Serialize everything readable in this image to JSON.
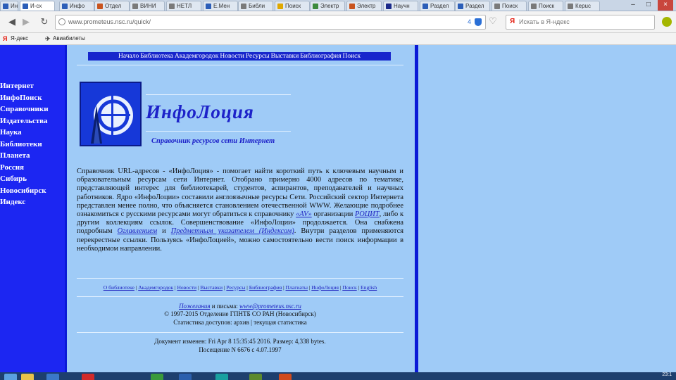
{
  "browser": {
    "tabs": [
      {
        "label": "Инфо",
        "icon": "page-icon",
        "color": "#2c5eb8"
      },
      {
        "label": "И-сх",
        "icon": "page-icon",
        "color": "#2c5eb8",
        "active": true
      },
      {
        "label": "Инфо",
        "icon": "page-icon",
        "color": "#2c5eb8"
      },
      {
        "label": "Отдел",
        "icon": "page-icon",
        "color": "#c9541f"
      },
      {
        "label": "ВИНИ",
        "icon": "page-icon",
        "color": "#7a7a7a"
      },
      {
        "label": "НЕТЛ",
        "icon": "page-icon",
        "color": "#7a7a7a"
      },
      {
        "label": "Е.Мен",
        "icon": "page-icon",
        "color": "#2c5eb8"
      },
      {
        "label": "Библи",
        "icon": "page-icon",
        "color": "#7a7a7a"
      },
      {
        "label": "Поиск",
        "icon": "page-icon",
        "color": "#e0a800"
      },
      {
        "label": "Электр",
        "icon": "page-icon",
        "color": "#3d8b3d"
      },
      {
        "label": "Электр",
        "icon": "page-icon",
        "color": "#c9541f"
      },
      {
        "label": "Научн",
        "icon": "page-icon",
        "color": "#1a2a8a"
      },
      {
        "label": "Раздел",
        "icon": "page-icon",
        "color": "#2c5eb8"
      },
      {
        "label": "Раздел",
        "icon": "page-icon",
        "color": "#2c5eb8"
      },
      {
        "label": "Поиск",
        "icon": "page-icon",
        "color": "#7a7a7a"
      },
      {
        "label": "Поиск",
        "icon": "page-icon",
        "color": "#7a7a7a"
      },
      {
        "label": "Кеpuс",
        "icon": "page-icon",
        "color": "#7a7a7a"
      }
    ],
    "url": "www.prometeus.nsc.ru/quick/",
    "url_count": "4",
    "search_placeholder": "Искать в Я-ндекс",
    "bookmarks": [
      {
        "label": "Я-декс",
        "icon": "yandex-icon"
      },
      {
        "label": "Авиабилеты",
        "icon": "plane-icon"
      }
    ]
  },
  "page": {
    "topnav": [
      "Начало",
      "Библиотека",
      "Академгородок",
      "Новости",
      "Ресурсы",
      "Выставки",
      "Библиография",
      "Поиск"
    ],
    "sidebar": [
      "Интернет",
      "ИнфоПоиск",
      "Справочники",
      "Издательства",
      "Наука",
      "Библиотеки",
      "Планета",
      "Россия",
      "Сибирь",
      "Новосибирск",
      "Индекс"
    ],
    "logo_title": "ИнфоЛоция",
    "logo_subtitle": "Справочник ресурсов сети Интернет",
    "paragraph": {
      "p1": "Справочник URL-адресов - «ИнфоЛоция» - помогает найти короткий путь к ключевым научным и образовательным ресурсам сети Интернет. Отобрано примерно 4000 адресов по тематике, представляющей интерес для библиотекарей, студентов, аспирантов, преподавателей и научных работников. Ядро «ИнфоЛоции» составили англоязычные ресурсы Сети. Российский сектор Интернета представлен менее полно, что объясняется становлением отечественной WWW. Желающие подробнее ознакомиться с русскими ресурсами могут обратиться к справочнику ",
      "link1": "«AV»",
      "p2": " организации ",
      "link2": "РОЦИТ",
      "p3": ", либо к другим коллекциям ссылок. Совершенствование «ИнфоЛоции» продолжается. Она снабжена подробным ",
      "link3": "Оглавлением",
      "p4": " и ",
      "link4": "Предметным указателем (Индексом)",
      "p5": ". Внутри разделов применяются перекрестные ссылки. Пользуясь «ИнфоЛоцией», можно самостоятельно вести поиск информации в необходимом направлении."
    },
    "bottomnav": [
      "О библиотеке",
      "Академгородок",
      "Новости",
      "Выставки",
      "Ресурсы",
      "Библиография",
      "Плагиаты",
      "ИнфоЛоция",
      "Поиск",
      "English"
    ],
    "contacts": {
      "feedback_link": "Пожелания",
      "letters_text": " и письма: ",
      "email": "www@prometeus.nsc.ru",
      "copyright": "© 1997-2015 Отделение ГПНТБ СО РАН (Новосибирск)",
      "stats": "Статистика доступов: архив | текущая статистика"
    },
    "footer": {
      "modified": "Документ изменен: Fri Apr 8 15:35:45 2016. Размер: 4,338 bytes.",
      "visits": "Посещение N 6676 с 4.07.1997"
    }
  },
  "taskbar": {
    "items": [
      {
        "icon": "start-icon",
        "color": "#5aa0e0"
      },
      {
        "icon": "explorer-icon",
        "color": "#e8c34a"
      },
      {
        "icon": "media-icon",
        "color": "#3b78c8"
      },
      {
        "icon": "opera-icon",
        "color": "#d22a2a"
      },
      {
        "icon": "app-icon",
        "color": "#3a9a3a"
      },
      {
        "icon": "word-icon",
        "color": "#2b5fad"
      },
      {
        "icon": "app-icon",
        "color": "#19a0a0"
      },
      {
        "icon": "app-icon",
        "color": "#5c8a2e"
      },
      {
        "icon": "powerpoint-icon",
        "color": "#d04a1c"
      }
    ],
    "clock": "23:1"
  }
}
